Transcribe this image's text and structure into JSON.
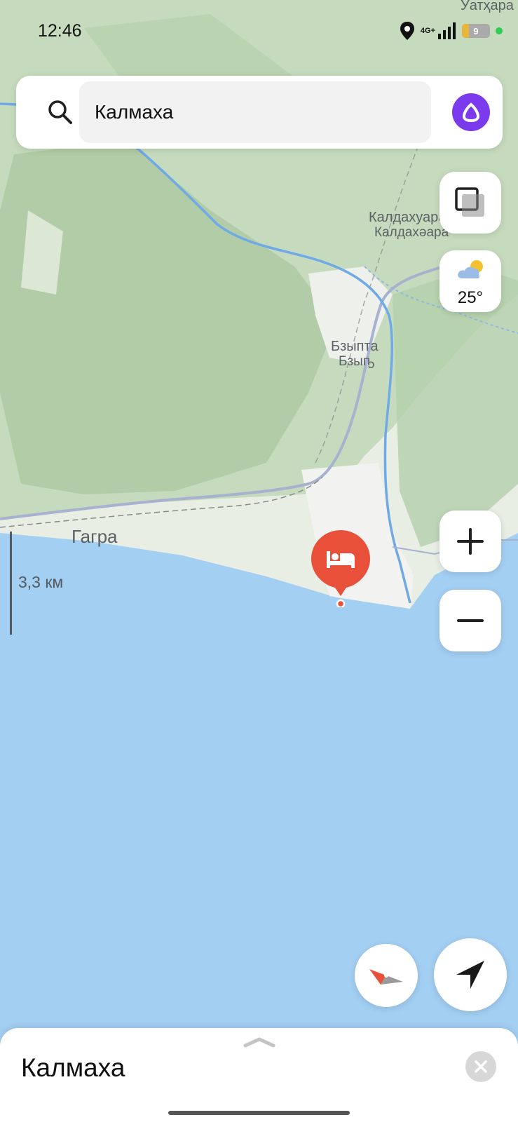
{
  "status_bar": {
    "time": "12:46",
    "network": "4G+",
    "battery": "9"
  },
  "search": {
    "query": "Калмаха",
    "search_icon": "search-icon",
    "assistant_icon": "alice-assistant-icon"
  },
  "map": {
    "labels": {
      "uathara": "Уатҳара",
      "kaldahuara_ru": "Калдахуара",
      "kaldahuara_ab": "Калдахәара",
      "bzypta_ru": "Бзыпта",
      "bzypta_ab": "Бзыҧ",
      "gagra": "Гагра"
    },
    "scale": "3,3 км",
    "marker_icon": "hotel-bed-icon"
  },
  "weather": {
    "temperature": "25°",
    "icon": "partly-cloudy-icon"
  },
  "controls": {
    "layers_icon": "layers-icon",
    "zoom_in_icon": "plus-icon",
    "zoom_out_icon": "minus-icon",
    "compass_icon": "compass-icon",
    "locate_icon": "navigation-arrow-icon"
  },
  "bottom_sheet": {
    "title": "Калмаха",
    "close_icon": "close-icon"
  },
  "colors": {
    "sea": "#a3cff3",
    "land": "#e9eee6",
    "forest": "#b9d2b0",
    "marker": "#e8503a",
    "accent": "#7c3aed"
  }
}
